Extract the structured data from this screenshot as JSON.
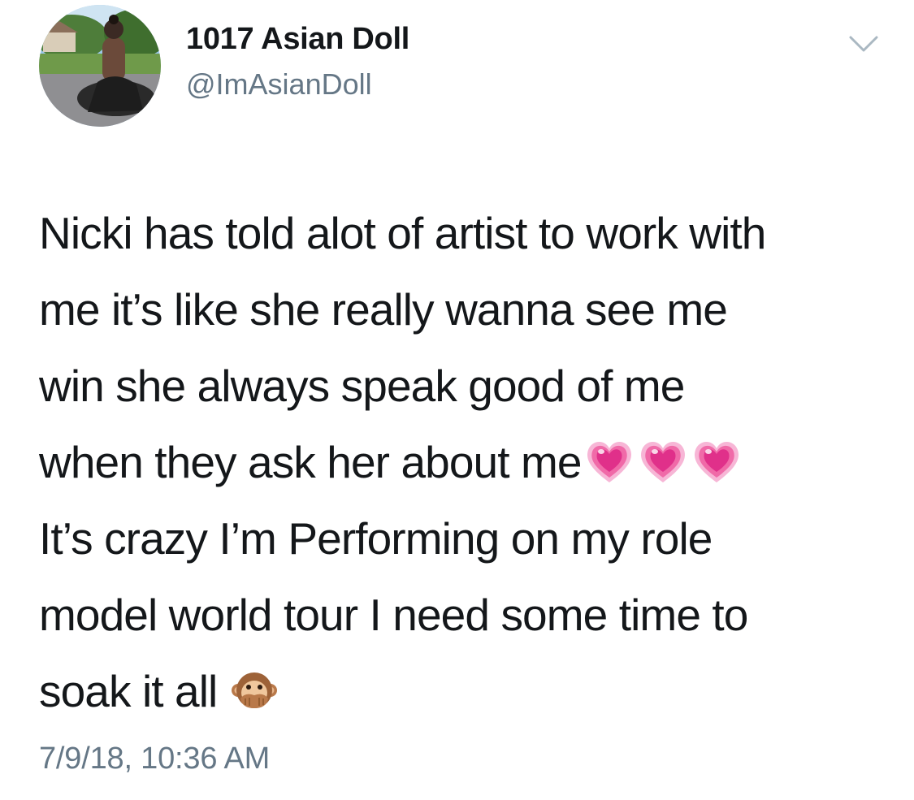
{
  "tweet": {
    "author": {
      "display_name": "1017 Asian Doll",
      "handle": "@ImAsianDoll",
      "avatar_icon": "profile-photo"
    },
    "menu_icon": "chevron-down-icon",
    "text_lines": [
      "Nicki has told alot of artist to work with",
      "me it’s like she really wanna see me",
      "win she always speak good of me",
      "when they ask her about me",
      "It’s crazy I’m Performing on my role",
      "model world tour I need some time to",
      "soak it all"
    ],
    "emojis": {
      "hearts": [
        "growing-heart-emoji",
        "growing-heart-emoji",
        "growing-heart-emoji"
      ],
      "monkey": "speak-no-evil-monkey-emoji"
    },
    "timestamp": "7/9/18, 10:36 AM",
    "colors": {
      "text": "#14171a",
      "secondary": "#657786",
      "caret": "#aab8c2",
      "heart": "#e8308a"
    }
  }
}
